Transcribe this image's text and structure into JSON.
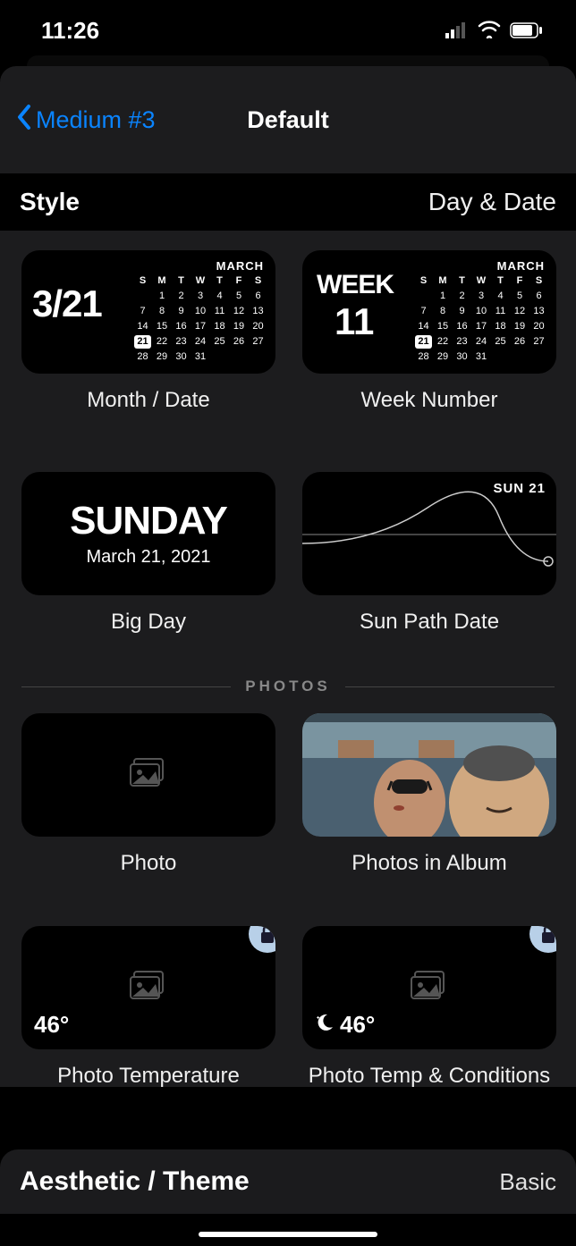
{
  "status": {
    "time": "11:26"
  },
  "nav": {
    "back_label": "Medium #3",
    "title": "Default"
  },
  "style_row": {
    "label": "Style",
    "value": "Day & Date"
  },
  "previews": {
    "month_date": {
      "label": "Month / Date",
      "big": "3/21",
      "month": "MARCH",
      "dow": [
        "S",
        "M",
        "T",
        "W",
        "T",
        "F",
        "S"
      ],
      "rows": [
        [
          "",
          "1",
          "2",
          "3",
          "4",
          "5",
          "6"
        ],
        [
          "7",
          "8",
          "9",
          "10",
          "11",
          "12",
          "13"
        ],
        [
          "14",
          "15",
          "16",
          "17",
          "18",
          "19",
          "20"
        ],
        [
          "21",
          "22",
          "23",
          "24",
          "25",
          "26",
          "27"
        ],
        [
          "28",
          "29",
          "30",
          "31",
          "",
          "",
          ""
        ]
      ],
      "today": "21"
    },
    "week_number": {
      "label": "Week Number",
      "week_label": "WEEK",
      "week_num": "11",
      "month": "MARCH"
    },
    "big_day": {
      "label": "Big Day",
      "day": "SUNDAY",
      "date": "March 21, 2021"
    },
    "sun_path": {
      "label": "Sun Path Date",
      "corner": "SUN 21"
    }
  },
  "photos_section": {
    "title": "PHOTOS",
    "items": {
      "photo": {
        "label": "Photo"
      },
      "album": {
        "label": "Photos in Album"
      },
      "temp": {
        "label": "Photo Temperature",
        "temp": "46°",
        "locked": true
      },
      "cond": {
        "label": "Photo Temp & Conditions",
        "temp": "46°",
        "locked": true
      }
    }
  },
  "aesthetic": {
    "label": "Aesthetic / Theme",
    "value": "Basic"
  }
}
